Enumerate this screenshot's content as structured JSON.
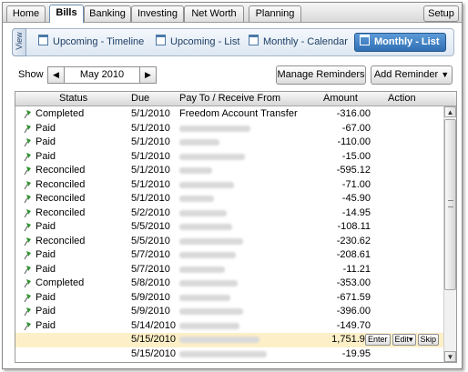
{
  "tabs": [
    {
      "label": "Home"
    },
    {
      "label": "Bills",
      "active": true
    },
    {
      "label": "Banking"
    },
    {
      "label": "Investing"
    },
    {
      "label": "Net Worth"
    },
    {
      "label": "Planning"
    }
  ],
  "setup_label": "Setup",
  "view": {
    "label": "View",
    "items": [
      {
        "label": "Upcoming - Timeline",
        "icon": "calendar-icon"
      },
      {
        "label": "Upcoming - List",
        "icon": "calendar-icon"
      },
      {
        "label": "Monthly - Calendar",
        "icon": "calendar-icon"
      },
      {
        "label": "Monthly - List",
        "icon": "calendar-icon",
        "active": true
      }
    ]
  },
  "show": {
    "label": "Show",
    "month": "May 2010",
    "prev_icon": "◀",
    "next_icon": "▶"
  },
  "buttons": {
    "manage": "Manage Reminders",
    "add": "Add Reminder",
    "add_arrow": "▼"
  },
  "table": {
    "columns": {
      "status": "Status",
      "due": "Due",
      "payee": "Pay To / Receive From",
      "amount": "Amount",
      "action": "Action"
    },
    "rows": [
      {
        "status": "Completed",
        "due": "5/1/2010",
        "payee": "Freedom Account Transfer",
        "amount": "-316.00"
      },
      {
        "status": "Paid",
        "due": "5/1/2010",
        "payee": "",
        "amount": "-67.00"
      },
      {
        "status": "Paid",
        "due": "5/1/2010",
        "payee": "",
        "amount": "-110.00"
      },
      {
        "status": "Paid",
        "due": "5/1/2010",
        "payee": "",
        "amount": "-15.00"
      },
      {
        "status": "Reconciled",
        "due": "5/1/2010",
        "payee": "",
        "amount": "-595.12"
      },
      {
        "status": "Reconciled",
        "due": "5/1/2010",
        "payee": "",
        "amount": "-71.00"
      },
      {
        "status": "Reconciled",
        "due": "5/1/2010",
        "payee": "",
        "amount": "-45.90"
      },
      {
        "status": "Reconciled",
        "due": "5/2/2010",
        "payee": "",
        "amount": "-14.95"
      },
      {
        "status": "Paid",
        "due": "5/5/2010",
        "payee": "",
        "amount": "-108.11"
      },
      {
        "status": "Reconciled",
        "due": "5/5/2010",
        "payee": "",
        "amount": "-230.62"
      },
      {
        "status": "Paid",
        "due": "5/7/2010",
        "payee": "",
        "amount": "-208.61"
      },
      {
        "status": "Paid",
        "due": "5/7/2010",
        "payee": "",
        "amount": "-11.21"
      },
      {
        "status": "Completed",
        "due": "5/8/2010",
        "payee": "",
        "amount": "-353.00"
      },
      {
        "status": "Paid",
        "due": "5/9/2010",
        "payee": "",
        "amount": "-671.59"
      },
      {
        "status": "Paid",
        "due": "5/9/2010",
        "payee": "",
        "amount": "-396.00"
      },
      {
        "status": "Paid",
        "due": "5/14/2010",
        "payee": "",
        "amount": "-149.70"
      },
      {
        "status": "",
        "due": "5/15/2010",
        "payee": "",
        "amount": "1,751.94",
        "highlight": true,
        "actions": [
          "Enter",
          "Edit▾",
          "Skip"
        ]
      },
      {
        "status": "",
        "due": "5/15/2010",
        "payee": "",
        "amount": "-19.95"
      }
    ]
  },
  "colors": {
    "accent": "#2f6fb3",
    "highlight_row": "#fdf0c8",
    "flag": "#2f8f2f"
  }
}
